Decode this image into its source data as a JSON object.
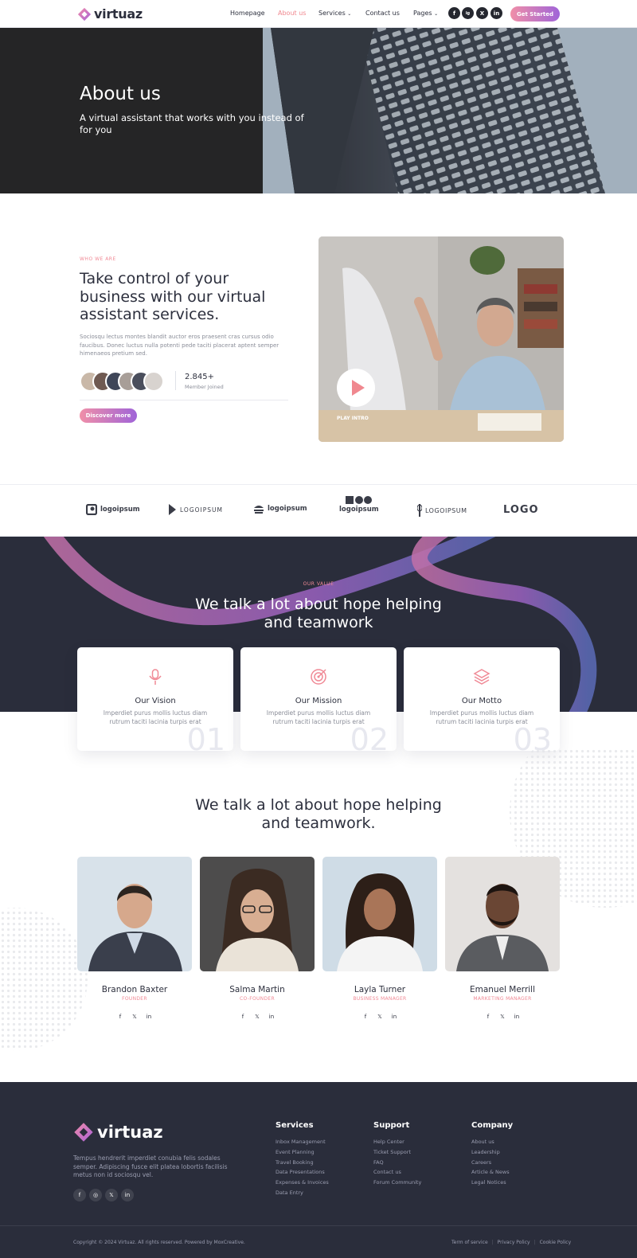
{
  "header": {
    "brand": "virtuaz",
    "nav": [
      "Homepage",
      "About us",
      "Services",
      "Contact us",
      "Pages"
    ],
    "social": [
      "f",
      "ig",
      "X",
      "in"
    ],
    "cta": "Get Started",
    "accent": "#f0888f"
  },
  "hero": {
    "title": "About us",
    "subtitle": "A virtual assistant that works with you instead of for you"
  },
  "about": {
    "eyebrow": "WHO WE ARE",
    "heading": "Take control of your business with our virtual assistant services.",
    "text": "Sociosqu lectus montes blandit auctor eros praesent cras cursus odio faucibus. Donec luctus nulla potenti pede taciti placerat aptent semper himenaeos pretium sed.",
    "members_count": "2.845+",
    "members_label": "Member Joined",
    "button": "Discover more",
    "video_label": "PLAY INTRO"
  },
  "logos": [
    "logoipsum",
    "LOGOIPSUM",
    "logoipsum",
    "logoipsum",
    "LOGOIPSUM",
    "LOGO"
  ],
  "values": {
    "eyebrow": "OUR VALUE",
    "heading": "We talk a lot about hope helping and teamwork",
    "cards": [
      {
        "title": "Our Vision",
        "text": "Imperdiet purus mollis luctus diam rutrum taciti lacinia turpis erat",
        "num": "01",
        "icon": "microphone-icon"
      },
      {
        "title": "Our Mission",
        "text": "Imperdiet purus mollis luctus diam rutrum taciti lacinia turpis erat",
        "num": "02",
        "icon": "target-icon"
      },
      {
        "title": "Our Motto",
        "text": "Imperdiet purus mollis luctus diam rutrum taciti lacinia turpis erat",
        "num": "03",
        "icon": "layers-icon"
      }
    ]
  },
  "team": {
    "heading": "We talk a lot about hope helping and teamwork.",
    "members": [
      {
        "name": "Brandon Baxter",
        "role": "FOUNDER"
      },
      {
        "name": "Salma Martin",
        "role": "CO-FOUNDER"
      },
      {
        "name": "Layla Turner",
        "role": "BUSINESS MANAGER"
      },
      {
        "name": "Emanuel Merrill",
        "role": "MARKETING MANAGER"
      }
    ]
  },
  "footer": {
    "brand": "virtuaz",
    "text": "Tempus hendrerit imperdiet conubia felis sodales semper. Adipiscing fusce elit platea lobortis facilisis metus non id sociosqu vel.",
    "columns": [
      {
        "title": "Services",
        "items": [
          "Inbox Management",
          "Event Planning",
          "Travel Booking",
          "Data Presentations",
          "Expenses & Invoices",
          "Data Entry"
        ]
      },
      {
        "title": "Support",
        "items": [
          "Help Center",
          "Ticket Support",
          "FAQ",
          "Contact us",
          "Forum Community"
        ]
      },
      {
        "title": "Company",
        "items": [
          "About us",
          "Leadership",
          "Careers",
          "Article & News",
          "Legal Notices"
        ]
      }
    ],
    "copyright": "Copyright © 2024 Virtuaz. All rights reserved. Powered by MoxCreative.",
    "legal": [
      "Term of service",
      "Privacy Policy",
      "Cookie Policy"
    ]
  }
}
